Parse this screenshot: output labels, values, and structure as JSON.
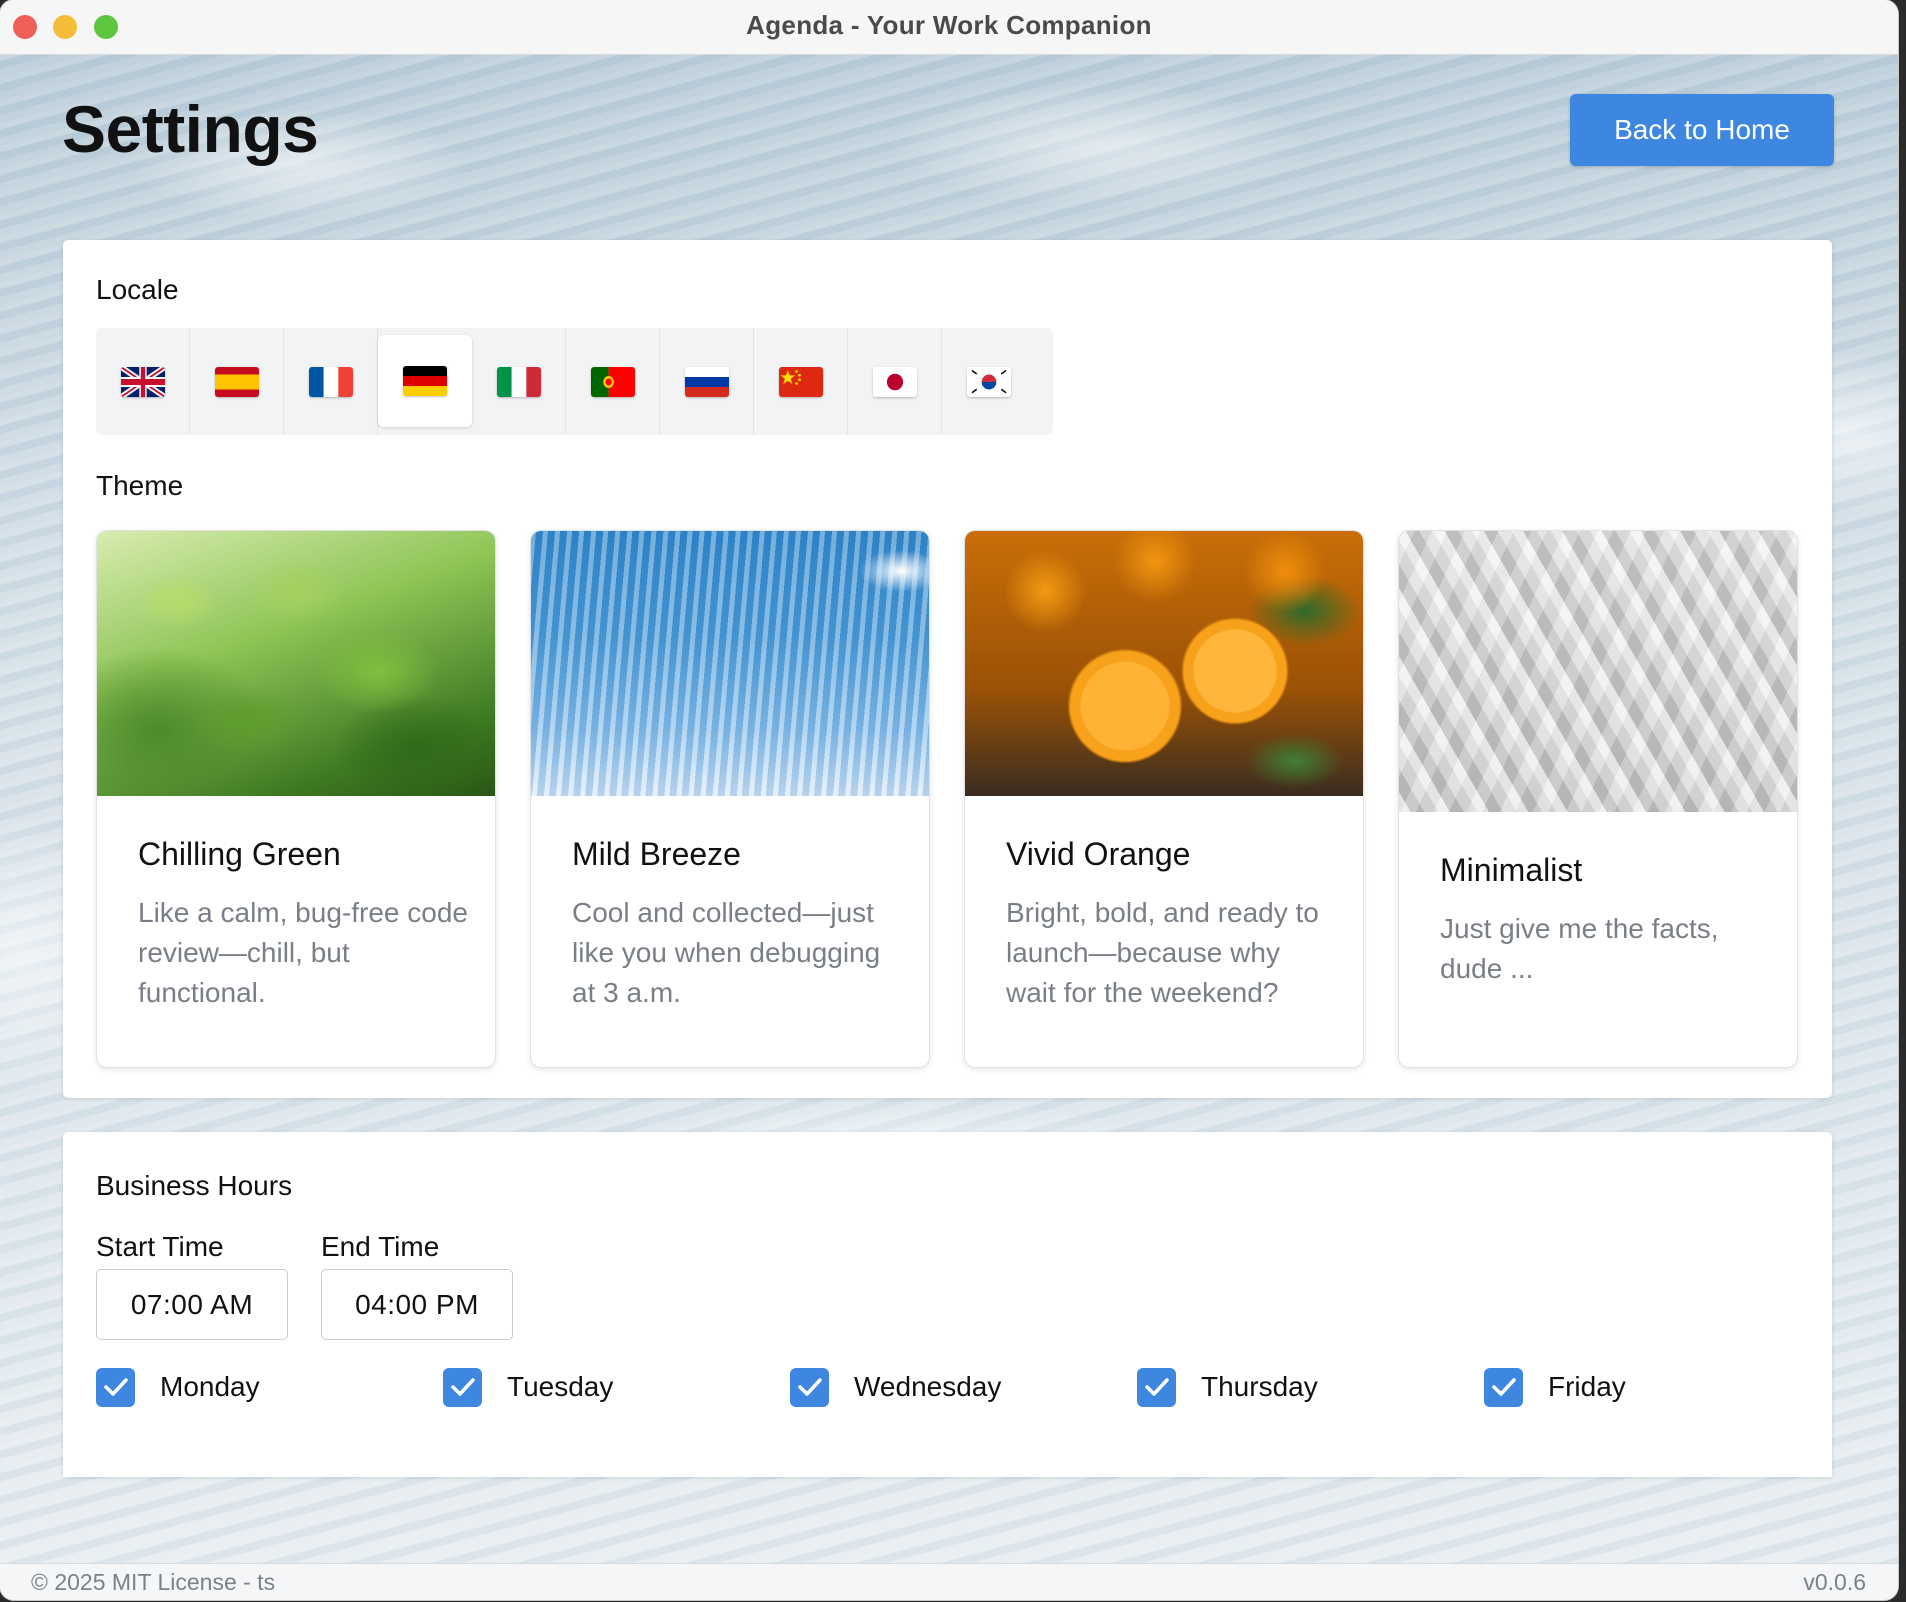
{
  "window": {
    "title": "Agenda - Your Work Companion"
  },
  "page": {
    "title": "Settings",
    "back_button": "Back to Home"
  },
  "locale": {
    "label": "Locale",
    "selected": "de",
    "flags": [
      {
        "code": "gb",
        "icon": "uk-flag-icon"
      },
      {
        "code": "es",
        "icon": "spain-flag-icon"
      },
      {
        "code": "fr",
        "icon": "france-flag-icon"
      },
      {
        "code": "de",
        "icon": "germany-flag-icon"
      },
      {
        "code": "it",
        "icon": "italy-flag-icon"
      },
      {
        "code": "pt",
        "icon": "portugal-flag-icon"
      },
      {
        "code": "ru",
        "icon": "russia-flag-icon"
      },
      {
        "code": "cn",
        "icon": "china-flag-icon"
      },
      {
        "code": "jp",
        "icon": "japan-flag-icon"
      },
      {
        "code": "kr",
        "icon": "korea-flag-icon"
      }
    ]
  },
  "theme": {
    "label": "Theme",
    "cards": [
      {
        "name": "Chilling Green",
        "description": "Like a calm, bug-free code review—chill, but functional."
      },
      {
        "name": "Mild Breeze",
        "description": "Cool and collected—just like you when debugging at 3 a.m."
      },
      {
        "name": "Vivid Orange",
        "description": "Bright, bold, and ready to launch—because why wait for the weekend?"
      },
      {
        "name": "Minimalist",
        "description": "Just give me the facts, dude ..."
      }
    ]
  },
  "business_hours": {
    "label": "Business Hours",
    "start_label": "Start Time",
    "start_value": "07:00 AM",
    "end_label": "End Time",
    "end_value": "04:00 PM",
    "days": [
      {
        "label": "Monday",
        "checked": true
      },
      {
        "label": "Tuesday",
        "checked": true
      },
      {
        "label": "Wednesday",
        "checked": true
      },
      {
        "label": "Thursday",
        "checked": true
      },
      {
        "label": "Friday",
        "checked": true
      }
    ]
  },
  "footer": {
    "license": "© 2025 MIT License - ts",
    "version": "v0.0.6"
  },
  "colors": {
    "accent": "#3d87e0",
    "muted_text": "#7a7f87"
  }
}
